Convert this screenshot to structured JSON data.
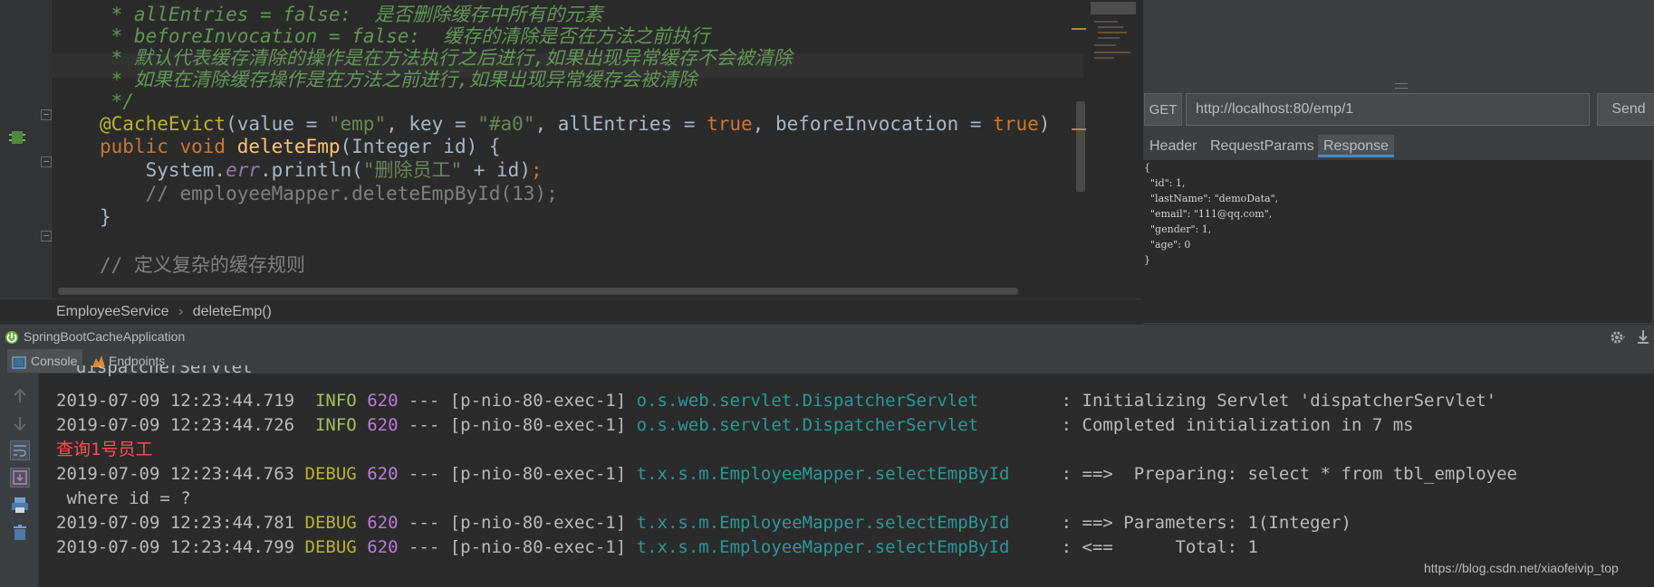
{
  "editor": {
    "lines": [
      {
        "id": "c1",
        "parts": [
          {
            "t": " * allEntries = false:  是否删除缓存中所有的元素",
            "c": "cmt"
          }
        ]
      },
      {
        "id": "c2",
        "parts": [
          {
            "t": " * beforeInvocation = false:  缓存的清除是否在方法之前执行",
            "c": "cmt"
          }
        ]
      },
      {
        "id": "c3",
        "parts": [
          {
            "t": " * 默认代表缓存清除的操作是在方法执行之后进行,如果出现异常缓存不会被清除",
            "c": "cmt"
          }
        ]
      },
      {
        "id": "c4",
        "parts": [
          {
            "t": " * 如果在清除缓存操作是在方法之前进行,如果出现异常缓存会被清除",
            "c": "cmt"
          }
        ]
      },
      {
        "id": "c5",
        "parts": [
          {
            "t": " */",
            "c": "cmt"
          }
        ]
      },
      {
        "id": "c6",
        "parts": [
          {
            "t": "@CacheEvict",
            "c": "ann"
          },
          {
            "t": "(value = ",
            "c": ""
          },
          {
            "t": "\"emp\"",
            "c": "str"
          },
          {
            "t": ", key = ",
            "c": ""
          },
          {
            "t": "\"#a0\"",
            "c": "str"
          },
          {
            "t": ", allEntries = ",
            "c": ""
          },
          {
            "t": "true",
            "c": "kw"
          },
          {
            "t": ", beforeInvocation = ",
            "c": ""
          },
          {
            "t": "true",
            "c": "kw"
          },
          {
            "t": ")",
            "c": ""
          }
        ]
      },
      {
        "id": "c7",
        "parts": [
          {
            "t": "public void ",
            "c": "kw"
          },
          {
            "t": "deleteEmp",
            "c": "fn"
          },
          {
            "t": "(Integer id) {",
            "c": ""
          }
        ]
      },
      {
        "id": "c8",
        "parts": [
          {
            "t": "    System.",
            "c": ""
          },
          {
            "t": "err",
            "c": "static"
          },
          {
            "t": ".println(",
            "c": ""
          },
          {
            "t": "\"删除员工\"",
            "c": "str"
          },
          {
            "t": " + id)",
            "c": ""
          },
          {
            "t": ";",
            "c": "kw"
          }
        ]
      },
      {
        "id": "c9",
        "parts": [
          {
            "t": "    // employeeMapper.deleteEmpById(13);",
            "c": "linecmt"
          }
        ]
      },
      {
        "id": "c10",
        "parts": [
          {
            "t": "}",
            "c": ""
          }
        ]
      },
      {
        "id": "c11",
        "parts": [
          {
            "t": "",
            "c": ""
          }
        ]
      },
      {
        "id": "c12",
        "parts": [
          {
            "t": "// 定义复杂的缓存规则",
            "c": "linecmt"
          }
        ]
      }
    ],
    "breadcrumb": {
      "class_name": "EmployeeService",
      "separator": "›",
      "method_name": "deleteEmp()"
    }
  },
  "rest_client": {
    "method": "GET",
    "url": "http://localhost:80/emp/1",
    "send_label": "Send",
    "tabs": [
      {
        "label": "Header"
      },
      {
        "label": "RequestParams"
      },
      {
        "label": "Response"
      }
    ],
    "response_lines": [
      "{",
      "  \"id\": 1,",
      "  \"lastName\": \"demoData\",",
      "  \"email\": \"111@qq.com\",",
      "  \"gender\": 1,",
      "  \"age\": 0",
      "}"
    ]
  },
  "run_panel": {
    "title": "SpringBootCacheApplication",
    "tabs": {
      "console": "Console",
      "endpoints": "Endpoints"
    },
    "console_lines": [
      {
        "id": "l0",
        "parts": [
          {
            "t": "dispatcherServlet",
            "c": ""
          }
        ]
      },
      {
        "id": "l1",
        "parts": [
          {
            "t": "2019-07-09 12:23:44.719  ",
            "c": ""
          },
          {
            "t": "INFO",
            "c": "info"
          },
          {
            "t": " ",
            "c": ""
          },
          {
            "t": "620",
            "c": "pid"
          },
          {
            "t": " --- [p-nio-80-exec-1] ",
            "c": ""
          },
          {
            "t": "o.s.web.servlet.DispatcherServlet",
            "c": "logger"
          },
          {
            "t": "        : Initializing Servlet 'dispatcherServlet'",
            "c": ""
          }
        ]
      },
      {
        "id": "l2",
        "parts": [
          {
            "t": "2019-07-09 12:23:44.726  ",
            "c": ""
          },
          {
            "t": "INFO",
            "c": "info"
          },
          {
            "t": " ",
            "c": ""
          },
          {
            "t": "620",
            "c": "pid"
          },
          {
            "t": " --- [p-nio-80-exec-1] ",
            "c": ""
          },
          {
            "t": "o.s.web.servlet.DispatcherServlet",
            "c": "logger"
          },
          {
            "t": "        : Completed initialization in 7 ms",
            "c": ""
          }
        ]
      },
      {
        "id": "l3",
        "parts": [
          {
            "t": "查询1号员工",
            "c": "red"
          }
        ]
      },
      {
        "id": "l4",
        "parts": [
          {
            "t": "2019-07-09 12:23:44.763 ",
            "c": ""
          },
          {
            "t": "DEBUG",
            "c": "debug"
          },
          {
            "t": " ",
            "c": ""
          },
          {
            "t": "620",
            "c": "pid"
          },
          {
            "t": " --- [p-nio-80-exec-1] ",
            "c": ""
          },
          {
            "t": "t.x.s.m.EmployeeMapper.selectEmpById",
            "c": "logger"
          },
          {
            "t": "     : ==>  Preparing: select * from tbl_employee",
            "c": ""
          }
        ]
      },
      {
        "id": "l5",
        "parts": [
          {
            "t": " where id = ?",
            "c": ""
          }
        ]
      },
      {
        "id": "l6",
        "parts": [
          {
            "t": "2019-07-09 12:23:44.781 ",
            "c": ""
          },
          {
            "t": "DEBUG",
            "c": "debug"
          },
          {
            "t": " ",
            "c": ""
          },
          {
            "t": "620",
            "c": "pid"
          },
          {
            "t": " --- [p-nio-80-exec-1] ",
            "c": ""
          },
          {
            "t": "t.x.s.m.EmployeeMapper.selectEmpById",
            "c": "logger"
          },
          {
            "t": "     : ==> Parameters: 1(Integer)",
            "c": ""
          }
        ]
      },
      {
        "id": "l7",
        "parts": [
          {
            "t": "2019-07-09 12:23:44.799 ",
            "c": ""
          },
          {
            "t": "DEBUG",
            "c": "debug"
          },
          {
            "t": " ",
            "c": ""
          },
          {
            "t": "620",
            "c": "pid"
          },
          {
            "t": " --- [p-nio-80-exec-1] ",
            "c": ""
          },
          {
            "t": "t.x.s.m.EmployeeMapper.selectEmpById",
            "c": "logger"
          },
          {
            "t": "     : <==      Total: 1",
            "c": ""
          }
        ]
      }
    ]
  },
  "watermark": "https://blog.csdn.net/xiaofeivip_top",
  "icons": {
    "settings": "gear-icon",
    "pin": "pin-icon",
    "up": "up-arrow-icon",
    "down": "down-arrow-icon",
    "wrap": "soft-wrap-icon",
    "scroll": "scroll-to-end-icon",
    "print": "print-icon",
    "trash": "trash-icon"
  },
  "colors": {
    "background": "#2b2b2b",
    "panel": "#3c3f41",
    "keyword": "#cc7832",
    "string": "#6a8759",
    "annotation": "#bbb529",
    "function": "#ffc66d",
    "logger": "#299999",
    "error": "#ff4f4f"
  }
}
